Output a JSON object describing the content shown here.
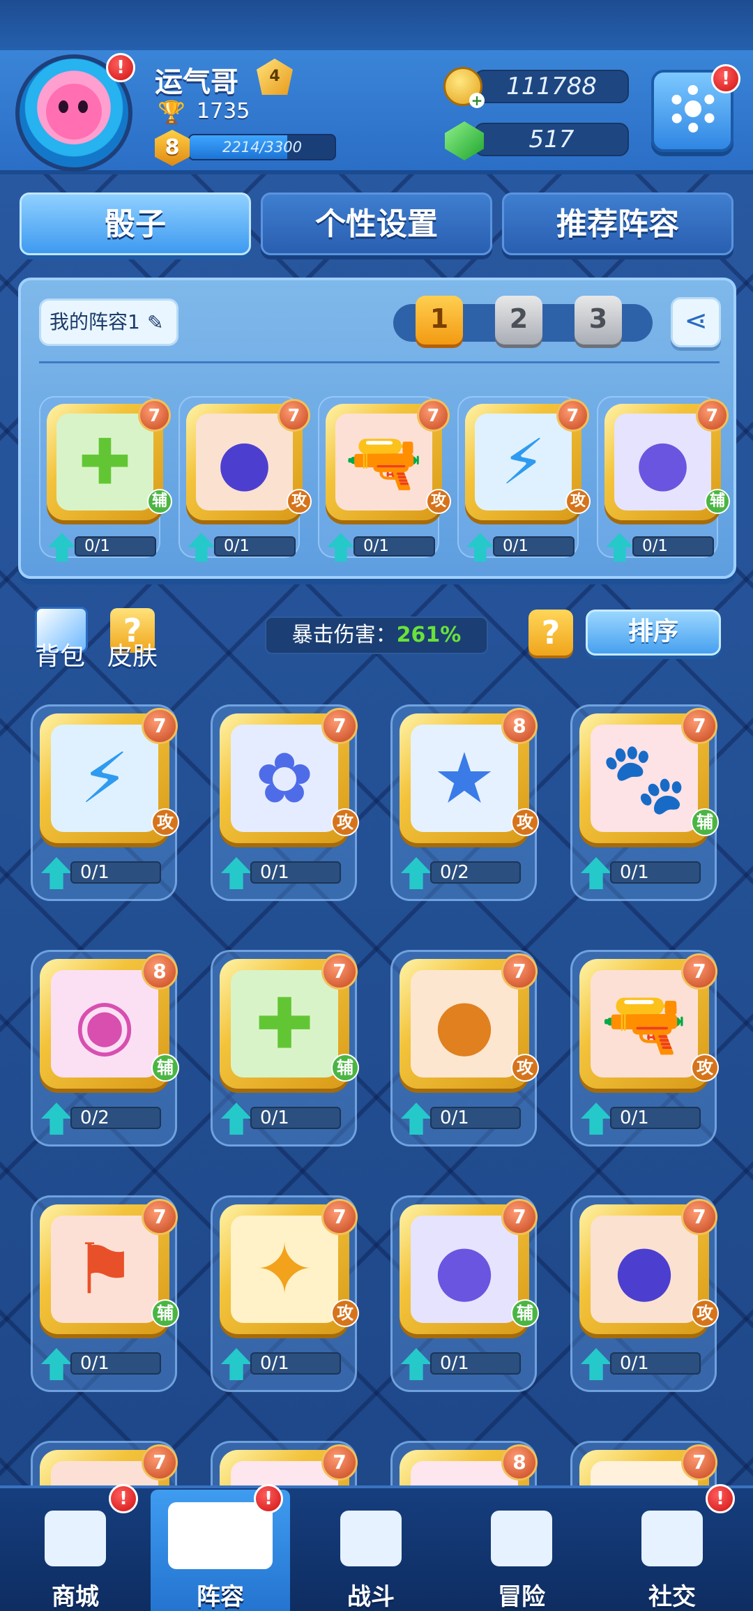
{
  "player": {
    "name": "运气哥",
    "rank_badge": "4",
    "trophies": "1735",
    "level": "8",
    "xp_text": "2214/3300",
    "xp_fraction": 0.671
  },
  "currency": {
    "gold": "111788",
    "gems": "517"
  },
  "alerts": {
    "mark": "!"
  },
  "tabs": [
    {
      "label": "骰子",
      "active": true
    },
    {
      "label": "个性设置",
      "active": false
    },
    {
      "label": "推荐阵容",
      "active": false
    }
  ],
  "deck": {
    "name": "我的阵容1",
    "slots": [
      {
        "label": "1",
        "active": true
      },
      {
        "label": "2",
        "active": false
      },
      {
        "label": "3",
        "active": false
      }
    ],
    "cards": [
      {
        "icon": "green-cross-icon",
        "art": "✚",
        "color": "#62c634",
        "bg": "#d9f3c8",
        "level": "7",
        "type": "辅",
        "type_class": "sup",
        "progress": "0/1"
      },
      {
        "icon": "purple-bomb-icon",
        "art": "●",
        "color": "#4c3fd0",
        "bg": "#fbe1d0",
        "level": "7",
        "type": "攻",
        "type_class": "atk",
        "progress": "0/1"
      },
      {
        "icon": "red-gun-icon",
        "art": "🔫",
        "color": "#e8532a",
        "bg": "#fde0d5",
        "level": "7",
        "type": "攻",
        "type_class": "atk",
        "progress": "0/1"
      },
      {
        "icon": "lightning-icon",
        "art": "⚡",
        "color": "#2f9bf0",
        "bg": "#dff1ff",
        "level": "7",
        "type": "攻",
        "type_class": "atk",
        "progress": "0/1"
      },
      {
        "icon": "purple-ghost-icon",
        "art": "●",
        "color": "#6a55e0",
        "bg": "#e6e3ff",
        "level": "7",
        "type": "辅",
        "type_class": "sup",
        "progress": "0/1"
      }
    ]
  },
  "toolbar": {
    "bag": "背包",
    "skin": "皮肤",
    "skin_mark": "?",
    "crit_label": "暴击伤害：",
    "crit_value": "261%",
    "help_mark": "?",
    "sort": "排序"
  },
  "inventory": [
    {
      "icon": "lightning-icon",
      "art": "⚡",
      "color": "#2f9bf0",
      "bg": "#dff1ff",
      "level": "7",
      "type": "攻",
      "type_class": "atk",
      "progress": "0/1"
    },
    {
      "icon": "blue-flower-icon",
      "art": "✿",
      "color": "#4f6ce8",
      "bg": "#e6ecff",
      "level": "7",
      "type": "攻",
      "type_class": "atk",
      "progress": "0/1"
    },
    {
      "icon": "blue-stars-icon",
      "art": "★",
      "color": "#3a7be8",
      "bg": "#e6f1ff",
      "level": "8",
      "type": "攻",
      "type_class": "atk",
      "progress": "0/2"
    },
    {
      "icon": "red-paw-icon",
      "art": "🐾",
      "color": "#e0324a",
      "bg": "#fde2e6",
      "level": "7",
      "type": "辅",
      "type_class": "sup",
      "progress": "0/1"
    },
    {
      "icon": "pink-eye-icon",
      "art": "◉",
      "color": "#d84fb0",
      "bg": "#fbe0f4",
      "level": "8",
      "type": "辅",
      "type_class": "sup",
      "progress": "0/2"
    },
    {
      "icon": "green-cross-icon",
      "art": "✚",
      "color": "#62c634",
      "bg": "#d9f3c8",
      "level": "7",
      "type": "辅",
      "type_class": "sup",
      "progress": "0/1"
    },
    {
      "icon": "orange-bread-icon",
      "art": "●",
      "color": "#e0801f",
      "bg": "#fde6d0",
      "level": "7",
      "type": "攻",
      "type_class": "atk",
      "progress": "0/1"
    },
    {
      "icon": "red-gun-icon",
      "art": "🔫",
      "color": "#e8532a",
      "bg": "#fde0d5",
      "level": "7",
      "type": "攻",
      "type_class": "atk",
      "progress": "0/1"
    },
    {
      "icon": "red-flag-icon",
      "art": "⚑",
      "color": "#e8502a",
      "bg": "#fde0d5",
      "level": "7",
      "type": "辅",
      "type_class": "sup",
      "progress": "0/1"
    },
    {
      "icon": "gold-star-icon",
      "art": "✦",
      "color": "#f2a21b",
      "bg": "#fff1c8",
      "level": "7",
      "type": "攻",
      "type_class": "atk",
      "progress": "0/1"
    },
    {
      "icon": "purple-ghost-icon",
      "art": "●",
      "color": "#6a55e0",
      "bg": "#e6e3ff",
      "level": "7",
      "type": "辅",
      "type_class": "sup",
      "progress": "0/1"
    },
    {
      "icon": "purple-bomb-icon",
      "art": "●",
      "color": "#4c3fd0",
      "bg": "#fbe1d0",
      "level": "7",
      "type": "攻",
      "type_class": "atk",
      "progress": "0/1"
    },
    {
      "icon": "red-card-icon",
      "art": "●",
      "color": "#e85a2a",
      "bg": "#fde0d5",
      "level": "7",
      "type": "",
      "type_class": "",
      "progress": ""
    },
    {
      "icon": "pink-card-icon",
      "art": "●",
      "color": "#e8729a",
      "bg": "#fde6ee",
      "level": "7",
      "type": "",
      "type_class": "",
      "progress": ""
    },
    {
      "icon": "red-star-card-icon",
      "art": "★",
      "color": "#d8323a",
      "bg": "#fde6ee",
      "level": "8",
      "type": "",
      "type_class": "",
      "progress": ""
    },
    {
      "icon": "orange-card-icon",
      "art": "●",
      "color": "#f08a1c",
      "bg": "#fff1dc",
      "level": "7",
      "type": "",
      "type_class": "",
      "progress": ""
    }
  ],
  "nav": [
    {
      "label": "商城",
      "icon": "shop-icon",
      "active": false,
      "alert": true
    },
    {
      "label": "阵容",
      "icon": "dice-icon",
      "active": true,
      "alert": true
    },
    {
      "label": "战斗",
      "icon": "crossed-swords-icon",
      "active": false,
      "alert": false
    },
    {
      "label": "冒险",
      "icon": "planet-icon",
      "active": false,
      "alert": false
    },
    {
      "label": "社交",
      "icon": "chat-bubbles-icon",
      "active": false,
      "alert": true
    }
  ]
}
